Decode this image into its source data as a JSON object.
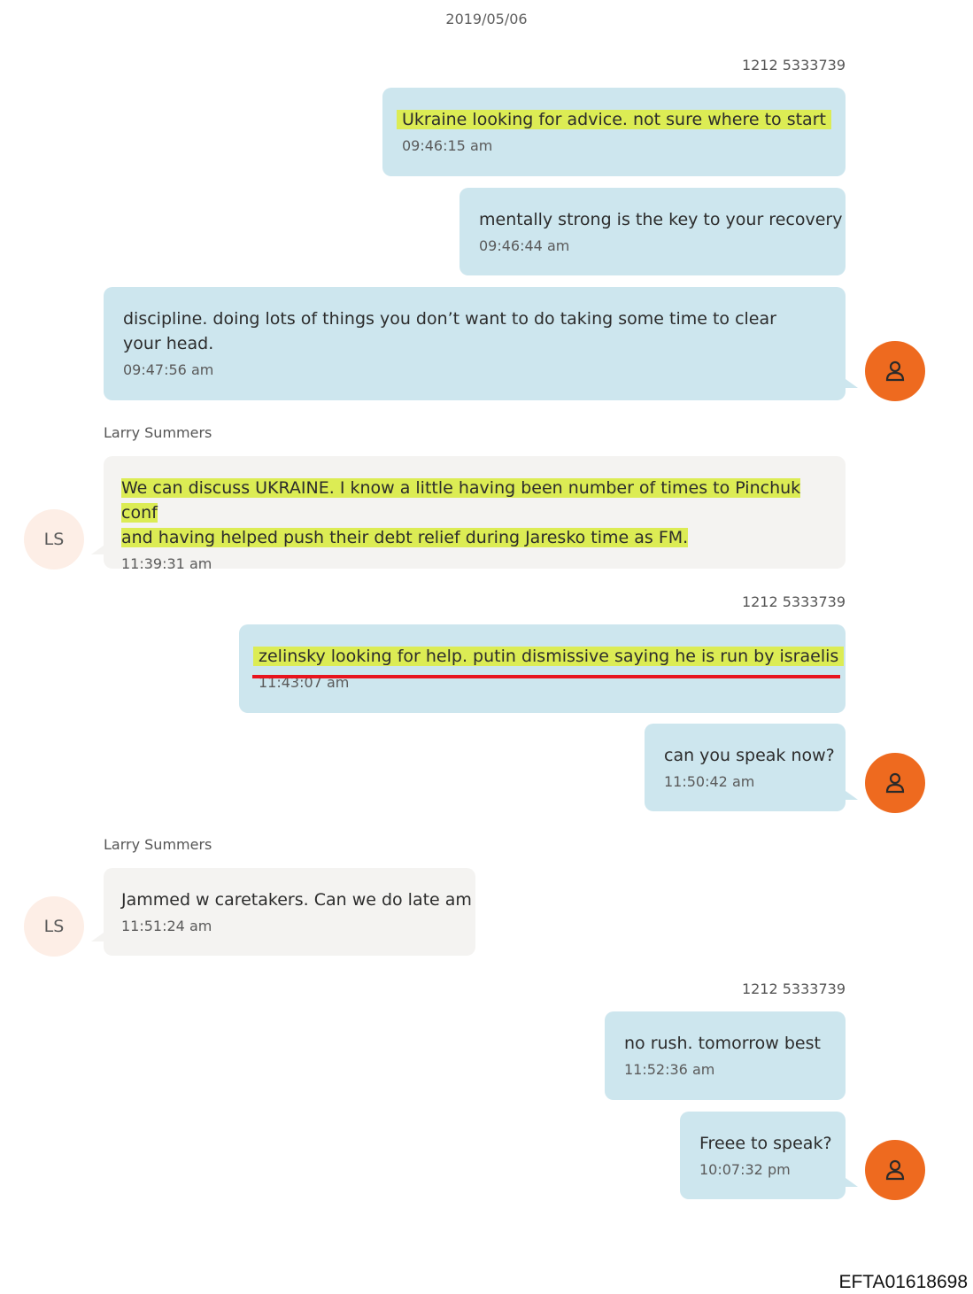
{
  "date": "2019/05/06",
  "senders": {
    "me": "1212 5333739",
    "ls": "Larry Summers"
  },
  "avatars": {
    "me_icon": "person-icon",
    "ls_initials": "LS"
  },
  "messages": [
    {
      "text": "Ukraine  looking for advice.    not sure where to start",
      "time": "09:46:15 am"
    },
    {
      "text": "mentally strong is the key  to your recovery",
      "time": "09:46:44 am"
    },
    {
      "text": "discipline. doing lots of things you don’t want to do   taking some time to clear your head.",
      "time": "09:47:56 am"
    },
    {
      "text": "We can discuss UKRAINE. I know a little having been number of times to Pinchuk conf and having helped push their debt relief during Jaresko time as FM.",
      "line1": "We can discuss UKRAINE. I know a little having been number of times to Pinchuk conf",
      "line2": "and having helped push their debt relief during Jaresko time as FM.",
      "time": "11:39:31 am"
    },
    {
      "text": "zelinsky looking for help.    putin dismissive  saying he is run by israelis",
      "time": "11:43:07 am"
    },
    {
      "text": "can you speak now?",
      "time": "11:50:42 am"
    },
    {
      "text": "Jammed w caretakers. Can we do late am",
      "time": "11:51:24 am"
    },
    {
      "text": "no rush.   tomorrow best",
      "time": "11:52:36 am"
    },
    {
      "text": "Freee to speak?",
      "time": "10:07:32 pm"
    }
  ],
  "colors": {
    "outgoing_bubble": "#cde6ee",
    "incoming_bubble": "#f4f3f1",
    "highlight": "#dcec54",
    "avatar_me": "#ee6a1f",
    "avatar_ls": "#fdeee6",
    "annotation_line": "#e8141e"
  },
  "footer_id": "EFTA01618698"
}
